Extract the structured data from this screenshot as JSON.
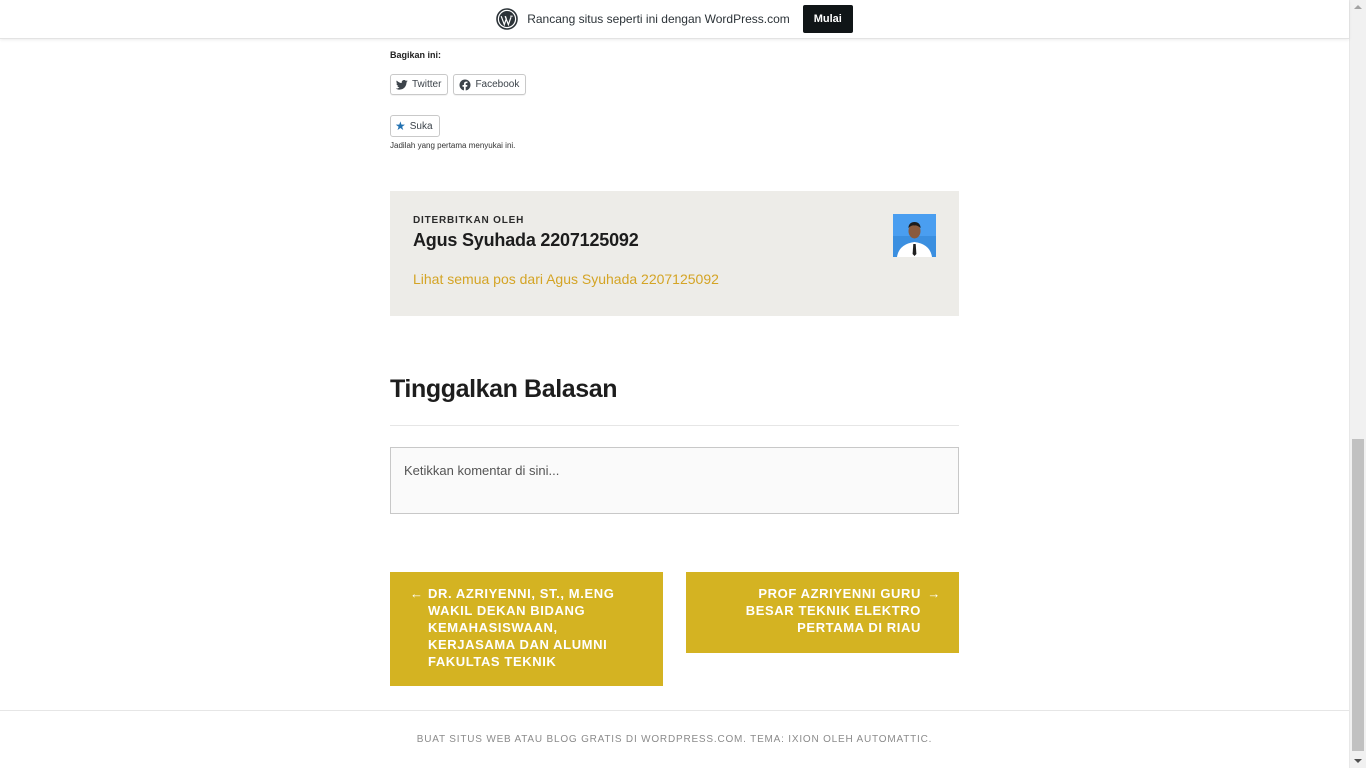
{
  "banner": {
    "logo_icon": "wordpress-logo-icon",
    "text": "Rancang situs seperti ini dengan WordPress.com",
    "button": "Mulai"
  },
  "share": {
    "title": "Bagikan ini:",
    "buttons": [
      {
        "icon": "twitter-icon",
        "label": "Twitter"
      },
      {
        "icon": "facebook-icon",
        "label": "Facebook"
      }
    ]
  },
  "like": {
    "icon": "star-icon",
    "label": "Suka",
    "note": "Jadilah yang pertama menyukai ini."
  },
  "author": {
    "kicker": "DITERBITKAN OLEH",
    "name": "Agus Syuhada 2207125092",
    "link": "Lihat semua pos dari Agus Syuhada 2207125092"
  },
  "reply": {
    "title": "Tinggalkan Balasan",
    "placeholder": "Ketikkan komentar di sini..."
  },
  "post_nav": {
    "prev_arrow": "←",
    "prev": "DR. AZRIYENNI, ST., M.ENG WAKIL DEKAN BIDANG KEMAHASISWAAN, KERJASAMA DAN ALUMNI FAKULTAS TEKNIK",
    "next_arrow": "→",
    "next": "PROF AZRIYENNI GURU BESAR TEKNIK ELEKTRO PERTAMA DI RIAU"
  },
  "footer": {
    "text": "BUAT SITUS WEB ATAU BLOG GRATIS DI WORDPRESS.COM. TEMA: IXION OLEH AUTOMATTIC."
  },
  "colors": {
    "accent_gold": "#d4b322",
    "link_gold": "#d4a425",
    "author_box_bg": "#edece8"
  }
}
